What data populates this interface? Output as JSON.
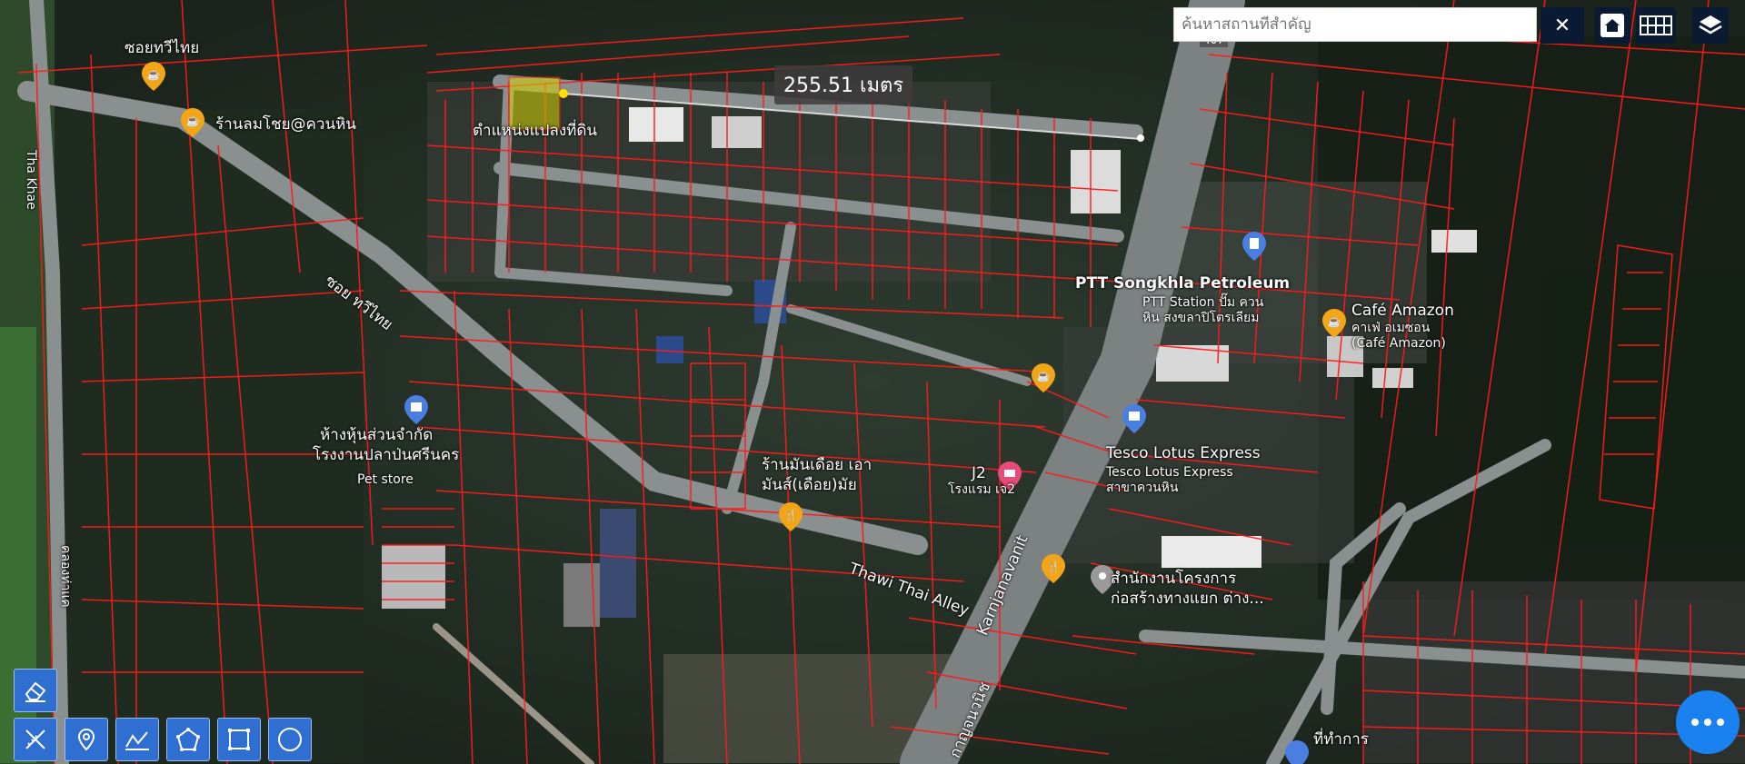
{
  "search": {
    "placeholder": "ค้นหาสถานที่สำคัญ",
    "value": "",
    "clear_label": "✕"
  },
  "measurement": {
    "value": "255.51 เมตร"
  },
  "road_badge": "407",
  "labels": {
    "soi_thawithai": "ซอยทวีไทย",
    "ran_lomchoi": "ร้านลมโชย@ควนหิน",
    "tha_khae": "Tha Khae",
    "plot_position": "ตำแหน่งแปลงที่ดิน",
    "soi_thawithai_road": "ซอย ทวีไทย",
    "ptt_title": "PTT Songkhla Petroleum",
    "ptt_sub1": "PTT Station ปั๊ม ควน",
    "ptt_sub2": "หิน สงขลาปิโตรเลียม",
    "cafe_amazon": "Café Amazon",
    "cafe_sub1": "คาเฟ่ อเมซอน",
    "cafe_sub2": "(Café Amazon)",
    "shop_1": "ห้างหุ้นส่วนจำกัด",
    "shop_2": "โรงงานปลาป่นศรีนคร",
    "pet_store": "Pet store",
    "noodle_1": "ร้านมันเดือย เอา",
    "noodle_2": "มันส์(เดือย)มัย",
    "hotel_j2": "J2",
    "hotel_j2_sub": "โรงแรม เจ2",
    "tesco": "Tesco Lotus Express",
    "tesco_sub1": "Tesco Lotus Express",
    "tesco_sub2": "สาขาควนหิน",
    "thawi_thai_alley": "Thawi Thai Alley",
    "karnjanavanit": "Karnjanavanit",
    "kanchanawanit_th": "กาญจนวนิช",
    "office_1": "สำนักงานโครงการ",
    "office_2": "ก่อสร้างทางแยก ต่าง...",
    "khlong": "คลองท่าแค",
    "gov_office": "ที่ทำการ"
  },
  "toolbar": {
    "home": "home-icon",
    "grid": "grid-icon",
    "layers": "layers-icon"
  },
  "tools": [
    "eraser-icon",
    "measure-icon",
    "pin-icon",
    "line-icon",
    "polygon-icon",
    "rectangle-icon",
    "circle-icon"
  ],
  "colors": {
    "parcel": "#ff1a1a",
    "selected": "#d4d400",
    "toolbar": "#0b1a33",
    "tool": "#2f6fd1",
    "fab": "#1a82f0"
  }
}
